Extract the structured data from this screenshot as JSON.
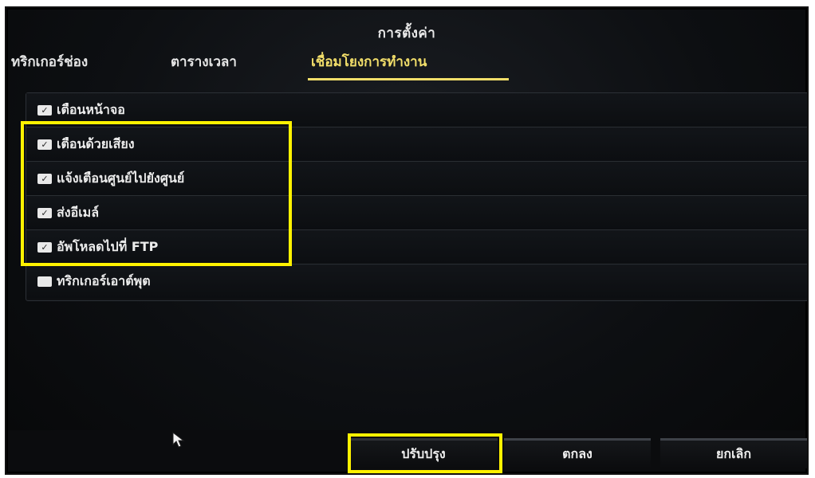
{
  "dialog": {
    "title": "การตั้งค่า"
  },
  "tabs": [
    {
      "label": "ทริกเกอร์ช่อง",
      "active": false
    },
    {
      "label": "ตารางเวลา",
      "active": false
    },
    {
      "label": "เชื่อมโยงการทำงาน",
      "active": true
    }
  ],
  "actions": [
    {
      "label": "เตือนหน้าจอ",
      "checked": true
    },
    {
      "label": "เตือนด้วยเสียง",
      "checked": true
    },
    {
      "label": "แจ้งเตือนศูนย์ไปยังศูนย์",
      "checked": true
    },
    {
      "label": "ส่งอีเมล์",
      "checked": true
    },
    {
      "label": "อัพโหลดไปที่ FTP",
      "checked": true
    },
    {
      "label": "ทริกเกอร์เอาต์พุต",
      "checked": false
    }
  ],
  "buttons": {
    "update": "ปรับปรุง",
    "ok": "ตกลง",
    "cancel": "ยกเลิก"
  },
  "colors": {
    "active_tab": "#f2de6a",
    "highlight": "#fff200",
    "background": "#0d0f12"
  }
}
